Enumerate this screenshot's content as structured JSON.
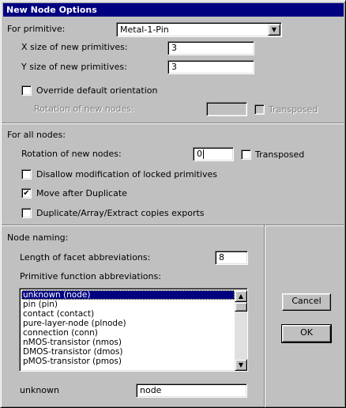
{
  "window": {
    "title": "New Node Options"
  },
  "primitive": {
    "label": "For primitive:",
    "selected": "Metal-1-Pin",
    "x_size_label": "X size of new primitives:",
    "x_size_value": "3",
    "y_size_label": "Y size of new primitives:",
    "y_size_value": "3",
    "override_label": "Override default orientation",
    "override_checked": false,
    "rotation_label": "Rotation of new nodes:",
    "rotation_value": "",
    "transposed_label": "Transposed",
    "transposed_checked": false
  },
  "all_nodes": {
    "section_label": "For all nodes:",
    "rotation_label": "Rotation of new nodes:",
    "rotation_value": "0",
    "transposed_label": "Transposed",
    "transposed_checked": false,
    "disallow_label": "Disallow modification of locked primitives",
    "disallow_checked": false,
    "move_after_label": "Move after Duplicate",
    "move_after_checked": true,
    "copies_exports_label": "Duplicate/Array/Extract copies exports",
    "copies_exports_checked": false
  },
  "naming": {
    "section_label": "Node naming:",
    "facet_abbrev_label": "Length of facet abbreviations:",
    "facet_abbrev_value": "8",
    "prim_func_label": "Primitive function abbreviations:",
    "list_items": [
      "unknown (node)",
      "pin (pin)",
      "contact (contact)",
      "pure-layer-node (plnode)",
      "connection (conn)",
      "nMOS-transistor (nmos)",
      "DMOS-transistor (dmos)",
      "pMOS-transistor (pmos)"
    ],
    "selected_index": 0,
    "selected_name_label": "unknown",
    "selected_abbrev_value": "node"
  },
  "buttons": {
    "cancel": "Cancel",
    "ok": "OK"
  },
  "icons": {
    "check": "✔",
    "dropdown_arrow": "▼",
    "scroll_up": "▲",
    "scroll_down": "▼"
  }
}
